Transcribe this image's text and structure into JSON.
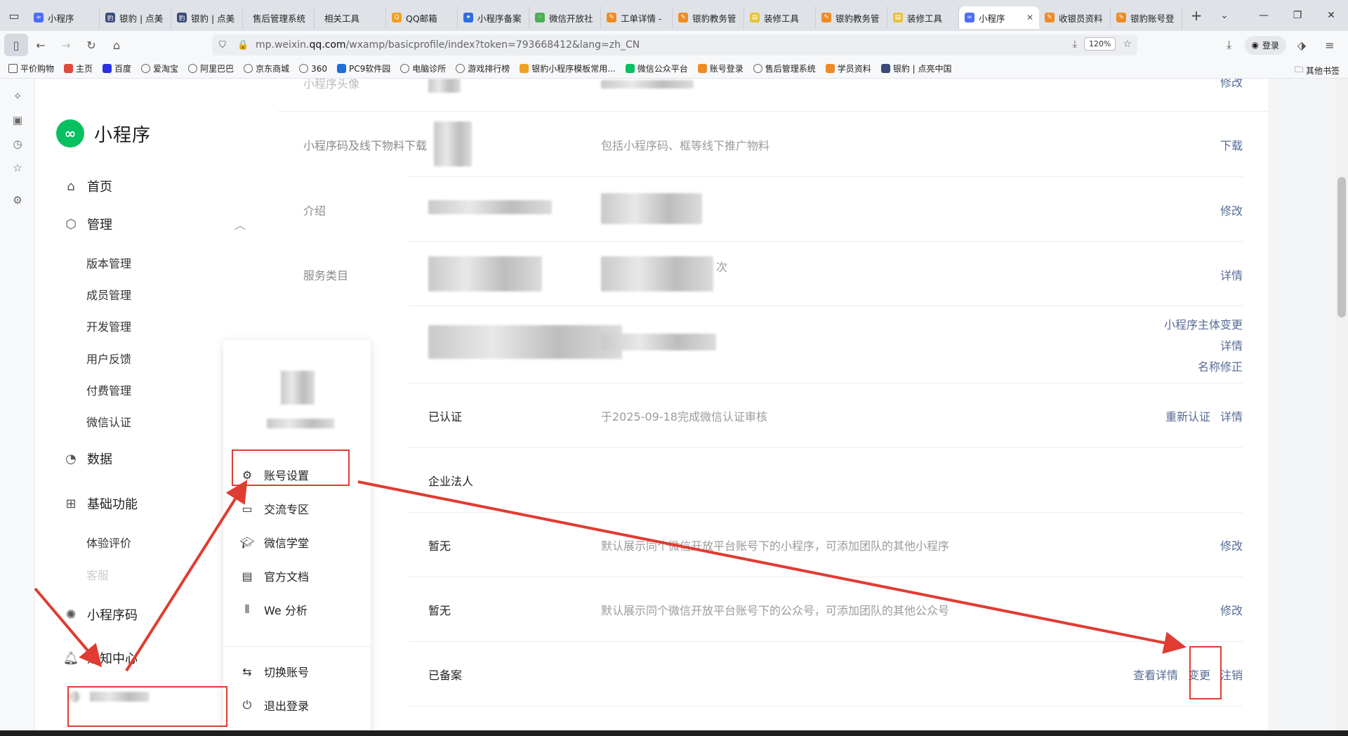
{
  "browser": {
    "tabs": [
      {
        "title": "小程序",
        "color": "#4c6ef5",
        "glyph": "∞"
      },
      {
        "title": "银豹 | 点美",
        "color": "#3a4a7a",
        "glyph": "豹"
      },
      {
        "title": "银豹 | 点美",
        "color": "#3a4a7a",
        "glyph": "豹"
      },
      {
        "title": "售后管理系统",
        "color": "",
        "glyph": ""
      },
      {
        "title": "相关工具",
        "color": "",
        "glyph": ""
      },
      {
        "title": "QQ邮箱",
        "color": "#f0a020",
        "glyph": "Q"
      },
      {
        "title": "小程序备案",
        "color": "#2f6fde",
        "glyph": "✦"
      },
      {
        "title": "微信开放社",
        "color": "#4caf50",
        "glyph": "⁘"
      },
      {
        "title": "工单详情 -",
        "color": "#f08a24",
        "glyph": "✎"
      },
      {
        "title": "银豹教务管",
        "color": "#f08a24",
        "glyph": "✎"
      },
      {
        "title": "装修工具",
        "color": "#e6c23a",
        "glyph": "▤"
      },
      {
        "title": "银豹教务管",
        "color": "#f08a24",
        "glyph": "✎"
      },
      {
        "title": "装修工具",
        "color": "#e6c23a",
        "glyph": "▤"
      },
      {
        "title": "小程序",
        "color": "#4c6ef5",
        "glyph": "∞",
        "active": true
      },
      {
        "title": "收银员资料",
        "color": "#f08a24",
        "glyph": "✎"
      },
      {
        "title": "银豹账号登",
        "color": "#f08a24",
        "glyph": "✎"
      }
    ],
    "url_prefix": "mp.weixin.",
    "url_domain": "qq.com",
    "url_path": "/wxamp/basicprofile/index?token=793668412&lang=zh_CN",
    "zoom": "120%",
    "login_label": "登录",
    "bookmarks": [
      {
        "label": "平价购物",
        "icon": "folder-icon",
        "color": ""
      },
      {
        "label": "主页",
        "icon": "home-icon",
        "color": "#e04a3a"
      },
      {
        "label": "百度",
        "icon": "baidu-icon",
        "color": "#2932e1"
      },
      {
        "label": "爱淘宝",
        "icon": "globe-icon",
        "color": ""
      },
      {
        "label": "阿里巴巴",
        "icon": "globe-icon",
        "color": ""
      },
      {
        "label": "京东商城",
        "icon": "globe-icon",
        "color": ""
      },
      {
        "label": "360",
        "icon": "globe-icon",
        "color": ""
      },
      {
        "label": "PC9软件园",
        "icon": "pc9-icon",
        "color": "#1e6fd9"
      },
      {
        "label": "电脑诊所",
        "icon": "globe-icon",
        "color": ""
      },
      {
        "label": "游戏排行榜",
        "icon": "globe-icon",
        "color": ""
      },
      {
        "label": "银豹小程序模板常用...",
        "icon": "bookmark-icon",
        "color": "#f0a020"
      },
      {
        "label": "微信公众平台",
        "icon": "wechat-icon",
        "color": "#07c160"
      },
      {
        "label": "账号登录",
        "icon": "edit-icon",
        "color": "#f08a24"
      },
      {
        "label": "售后管理系统",
        "icon": "globe-icon",
        "color": ""
      },
      {
        "label": "学员资料",
        "icon": "edit-icon",
        "color": "#f08a24"
      },
      {
        "label": "银豹 | 点亮中国",
        "icon": "yinbao-icon",
        "color": "#3a4a7a"
      }
    ],
    "other_bookmarks": "其他书签"
  },
  "sidebar": {
    "brand": "小程序",
    "nav": [
      {
        "label": "首页",
        "icon": "home-icon"
      },
      {
        "label": "管理",
        "icon": "manage-icon"
      },
      {
        "label": "数据",
        "icon": "chart-icon"
      },
      {
        "label": "基础功能",
        "icon": "apps-icon"
      },
      {
        "label": "小程序码",
        "icon": "qrcode-icon"
      },
      {
        "label": "通知中心",
        "icon": "bell-icon"
      }
    ],
    "manage_sub": [
      "版本管理",
      "成员管理",
      "开发管理",
      "用户反馈",
      "付费管理",
      "微信认证"
    ],
    "basic_sub": [
      "体验评价",
      "客服"
    ]
  },
  "popup": {
    "items": [
      {
        "label": "账号设置",
        "icon": "gear-icon"
      },
      {
        "label": "交流专区",
        "icon": "chat-icon"
      },
      {
        "label": "微信学堂",
        "icon": "graduation-icon"
      },
      {
        "label": "官方文档",
        "icon": "document-icon"
      },
      {
        "label": "We 分析",
        "icon": "analytics-icon"
      },
      {
        "label": "切换账号",
        "icon": "switch-icon"
      },
      {
        "label": "退出登录",
        "icon": "power-icon"
      }
    ]
  },
  "content": {
    "rows": [
      {
        "label": "小程序头像",
        "value": "",
        "desc": "",
        "actions": [
          "修改"
        ]
      },
      {
        "label": "小程序码及线下物料下载",
        "value": "",
        "desc": "包括小程序码、框等线下推广物料",
        "actions": [
          "下载"
        ]
      },
      {
        "label": "介绍",
        "value": "",
        "desc": "",
        "actions": [
          "修改"
        ]
      },
      {
        "label": "服务类目",
        "value": "",
        "desc": "次",
        "actions": [
          "详情"
        ]
      },
      {
        "label": "",
        "value": "",
        "desc": "",
        "actions": [
          "小程序主体变更",
          "详情",
          "名称修正"
        ]
      },
      {
        "label": "",
        "value": "已认证",
        "desc": "于2025-09-18完成微信认证审核",
        "actions": [
          "重新认证",
          "详情"
        ]
      },
      {
        "label": "",
        "value": "企业法人",
        "desc": "",
        "actions": []
      },
      {
        "label": "",
        "value": "暂无",
        "desc": "默认展示同个微信开放平台账号下的小程序，可添加团队的其他小程序",
        "actions": [
          "修改"
        ]
      },
      {
        "label": "",
        "value": "暂无",
        "desc": "默认展示同个微信开放平台账号下的公众号，可添加团队的其他公众号",
        "actions": [
          "修改"
        ]
      },
      {
        "label": "",
        "value": "已备案",
        "desc": "",
        "actions": [
          "查看详情",
          "变更",
          "注销"
        ]
      }
    ]
  },
  "colors": {
    "accent_link": "#576b95",
    "wechat_green": "#07c160",
    "annotation_red": "#e03c31"
  }
}
